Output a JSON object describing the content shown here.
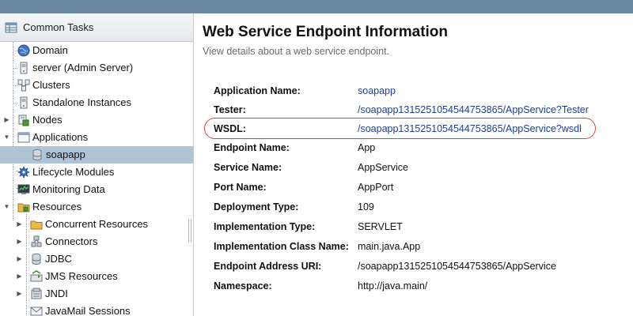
{
  "sidebar": {
    "header": "Common Tasks",
    "items": [
      {
        "label": "Domain",
        "icon": "globe-icon"
      },
      {
        "label": "server (Admin Server)",
        "icon": "server-icon"
      },
      {
        "label": "Clusters",
        "icon": "clusters-icon"
      },
      {
        "label": "Standalone Instances",
        "icon": "server-icon"
      },
      {
        "label": "Nodes",
        "icon": "nodes-icon"
      },
      {
        "label": "Applications",
        "icon": "window-icon"
      },
      {
        "label": "soapapp",
        "icon": "database-icon"
      },
      {
        "label": "Lifecycle Modules",
        "icon": "gear-icon"
      },
      {
        "label": "Monitoring Data",
        "icon": "monitor-icon"
      },
      {
        "label": "Resources",
        "icon": "resources-icon"
      },
      {
        "label": "Concurrent Resources",
        "icon": "folder-icon"
      },
      {
        "label": "Connectors",
        "icon": "connector-icon"
      },
      {
        "label": "JDBC",
        "icon": "database-icon"
      },
      {
        "label": "JMS Resources",
        "icon": "jms-icon"
      },
      {
        "label": "JNDI",
        "icon": "jndi-icon"
      },
      {
        "label": "JavaMail Sessions",
        "icon": "mail-icon"
      }
    ]
  },
  "main": {
    "title": "Web Service Endpoint Information",
    "description": "View details about a web service endpoint.",
    "properties": [
      {
        "label": "Application Name:",
        "value": "soapapp"
      },
      {
        "label": "Tester:",
        "value": "/soapapp1315251054544753865/AppService?Tester"
      },
      {
        "label": "WSDL:",
        "value": "/soapapp1315251054544753865/AppService?wsdl"
      },
      {
        "label": "Endpoint Name:",
        "value": "App"
      },
      {
        "label": "Service Name:",
        "value": "AppService"
      },
      {
        "label": "Port Name:",
        "value": "AppPort"
      },
      {
        "label": "Deployment Type:",
        "value": "109"
      },
      {
        "label": "Implementation Type:",
        "value": "SERVLET"
      },
      {
        "label": "Implementation Class Name:",
        "value": "main.java.App"
      },
      {
        "label": "Endpoint Address URI:",
        "value": "/soapapp1315251054544753865/AppService"
      },
      {
        "label": "Namespace:",
        "value": "http://java.main/"
      }
    ]
  },
  "colors": {
    "link": "#1e3f94",
    "selected_row": "#b0c4d8",
    "highlight_oval": "#d64545",
    "top_bar": "#6d8aa5"
  }
}
